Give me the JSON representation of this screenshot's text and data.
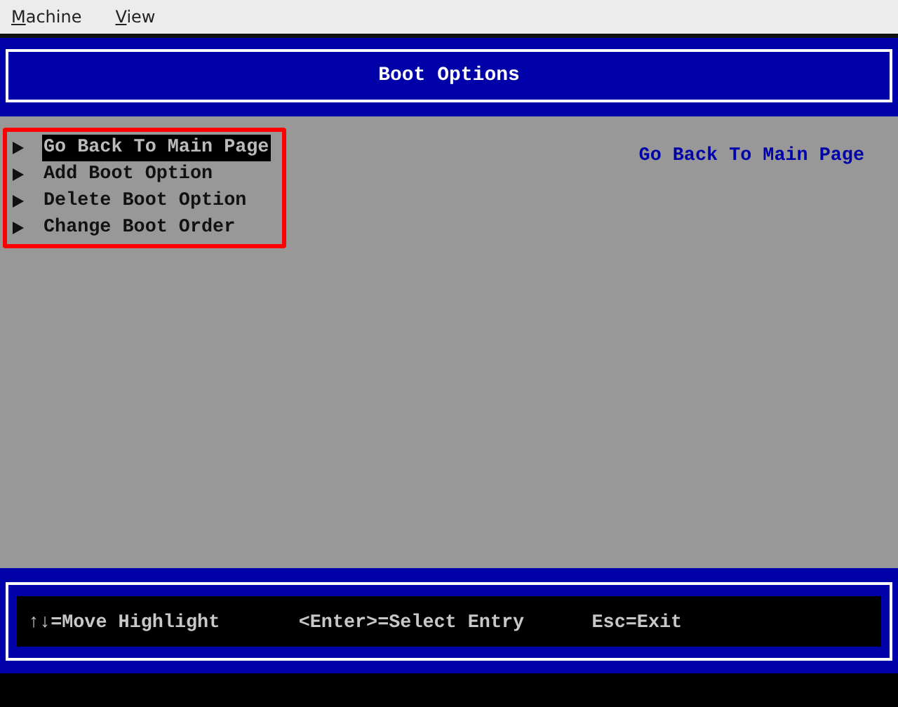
{
  "menu_bar": [
    {
      "label": "Machine"
    },
    {
      "label": "View"
    }
  ],
  "title": "Boot Options",
  "menu_items": [
    {
      "label": "Go Back To Main Page",
      "selected": true
    },
    {
      "label": "Add Boot Option",
      "selected": false
    },
    {
      "label": "Delete Boot Option",
      "selected": false
    },
    {
      "label": "Change Boot Order",
      "selected": false
    }
  ],
  "help_text": "Go Back To Main Page",
  "footer_hints": [
    "↑↓=Move Highlight",
    "<Enter>=Select Entry",
    "Esc=Exit"
  ]
}
